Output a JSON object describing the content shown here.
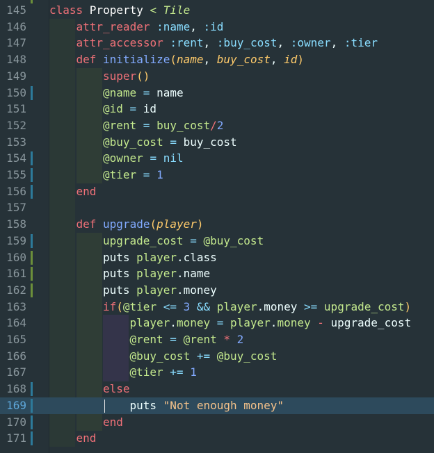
{
  "editor": {
    "theme_colors": {
      "background": "#263238",
      "line_number": "#89969c",
      "current_line": "#2d4a5c",
      "indent_guide": "#2e3b35",
      "git_modified": "#2d7a9a",
      "git_added": "#6c8f3a"
    },
    "current_line": 169,
    "lines": [
      {
        "num": "145",
        "indent": 0,
        "mark": "",
        "tokens": [
          [
            "kw",
            "class "
          ],
          [
            "cls",
            "Property "
          ],
          [
            "inh",
            "< Tile"
          ]
        ]
      },
      {
        "num": "146",
        "indent": 1,
        "mark": "",
        "tokens": [
          [
            "kw",
            "attr_reader "
          ],
          [
            "sym",
            ":name"
          ],
          [
            "id",
            ", "
          ],
          [
            "sym",
            ":id"
          ]
        ]
      },
      {
        "num": "147",
        "indent": 1,
        "mark": "",
        "tokens": [
          [
            "kw",
            "attr_accessor "
          ],
          [
            "sym",
            ":rent"
          ],
          [
            "id",
            ", "
          ],
          [
            "sym",
            ":buy_cost"
          ],
          [
            "id",
            ", "
          ],
          [
            "sym",
            ":owner"
          ],
          [
            "id",
            ", "
          ],
          [
            "sym",
            ":tier"
          ]
        ]
      },
      {
        "num": "148",
        "indent": 1,
        "mark": "",
        "tokens": [
          [
            "kw",
            "def "
          ],
          [
            "fn",
            "initialize"
          ],
          [
            "paren",
            "("
          ],
          [
            "param",
            "name"
          ],
          [
            "id",
            ", "
          ],
          [
            "param",
            "buy_cost"
          ],
          [
            "id",
            ", "
          ],
          [
            "param",
            "id"
          ],
          [
            "paren",
            ")"
          ]
        ]
      },
      {
        "num": "149",
        "indent": 2,
        "mark": "",
        "tokens": [
          [
            "kw",
            "super"
          ],
          [
            "paren",
            "()"
          ]
        ]
      },
      {
        "num": "150",
        "indent": 2,
        "mark": "mod",
        "tokens": [
          [
            "ivar",
            "@name "
          ],
          [
            "op",
            "= "
          ],
          [
            "id",
            "name"
          ]
        ]
      },
      {
        "num": "151",
        "indent": 2,
        "mark": "",
        "tokens": [
          [
            "ivar",
            "@id "
          ],
          [
            "op",
            "= "
          ],
          [
            "id",
            "id"
          ]
        ]
      },
      {
        "num": "152",
        "indent": 2,
        "mark": "",
        "tokens": [
          [
            "ivar",
            "@rent "
          ],
          [
            "op",
            "= "
          ],
          [
            "ivar",
            "buy_cost"
          ],
          [
            "kw",
            "/"
          ],
          [
            "num",
            "2"
          ]
        ]
      },
      {
        "num": "153",
        "indent": 2,
        "mark": "",
        "tokens": [
          [
            "ivar",
            "@buy_cost "
          ],
          [
            "op",
            "= "
          ],
          [
            "id",
            "buy_cost"
          ]
        ]
      },
      {
        "num": "154",
        "indent": 2,
        "mark": "mod",
        "tokens": [
          [
            "ivar",
            "@owner "
          ],
          [
            "op",
            "= "
          ],
          [
            "sym",
            "nil"
          ]
        ]
      },
      {
        "num": "155",
        "indent": 2,
        "mark": "mod",
        "tokens": [
          [
            "ivar",
            "@tier "
          ],
          [
            "op",
            "= "
          ],
          [
            "num",
            "1"
          ]
        ]
      },
      {
        "num": "156",
        "indent": 1,
        "mark": "mod",
        "tokens": [
          [
            "kw",
            "end"
          ]
        ]
      },
      {
        "num": "157",
        "indent": 0,
        "mark": "",
        "tokens": []
      },
      {
        "num": "158",
        "indent": 1,
        "mark": "",
        "tokens": [
          [
            "kw",
            "def "
          ],
          [
            "fn",
            "upgrade"
          ],
          [
            "paren",
            "("
          ],
          [
            "param",
            "player"
          ],
          [
            "paren",
            ")"
          ]
        ]
      },
      {
        "num": "159",
        "indent": 2,
        "mark": "mod",
        "tokens": [
          [
            "ivar",
            "upgrade_cost "
          ],
          [
            "op",
            "= "
          ],
          [
            "ivar",
            "@buy_cost"
          ]
        ]
      },
      {
        "num": "160",
        "indent": 2,
        "mark": "add",
        "tokens": [
          [
            "id",
            "puts "
          ],
          [
            "ivar",
            "player"
          ],
          [
            "id",
            "."
          ],
          [
            "id",
            "class"
          ]
        ]
      },
      {
        "num": "161",
        "indent": 2,
        "mark": "add",
        "tokens": [
          [
            "id",
            "puts "
          ],
          [
            "ivar",
            "player"
          ],
          [
            "id",
            "."
          ],
          [
            "id",
            "name"
          ]
        ]
      },
      {
        "num": "162",
        "indent": 2,
        "mark": "add",
        "tokens": [
          [
            "id",
            "puts "
          ],
          [
            "ivar",
            "player"
          ],
          [
            "id",
            "."
          ],
          [
            "id",
            "money"
          ]
        ]
      },
      {
        "num": "163",
        "indent": 2,
        "mark": "",
        "tokens": [
          [
            "kw",
            "if"
          ],
          [
            "paren",
            "("
          ],
          [
            "ivar",
            "@tier "
          ],
          [
            "op",
            "<= "
          ],
          [
            "num",
            "3 "
          ],
          [
            "op",
            "&& "
          ],
          [
            "ivar",
            "player"
          ],
          [
            "id",
            "."
          ],
          [
            "id",
            "money "
          ],
          [
            "op",
            ">= "
          ],
          [
            "ivar",
            "upgrade_cost"
          ],
          [
            "paren",
            ")"
          ]
        ]
      },
      {
        "num": "164",
        "indent": 3,
        "mark": "",
        "tokens": [
          [
            "ivar",
            "player"
          ],
          [
            "id",
            "."
          ],
          [
            "ivar",
            "money "
          ],
          [
            "op",
            "= "
          ],
          [
            "ivar",
            "player"
          ],
          [
            "id",
            "."
          ],
          [
            "ivar",
            "money "
          ],
          [
            "kw",
            "- "
          ],
          [
            "id",
            "upgrade_cost"
          ]
        ]
      },
      {
        "num": "165",
        "indent": 3,
        "mark": "",
        "tokens": [
          [
            "ivar",
            "@rent "
          ],
          [
            "op",
            "= "
          ],
          [
            "ivar",
            "@rent "
          ],
          [
            "kw",
            "* "
          ],
          [
            "num",
            "2"
          ]
        ]
      },
      {
        "num": "166",
        "indent": 3,
        "mark": "",
        "tokens": [
          [
            "ivar",
            "@buy_cost "
          ],
          [
            "op",
            "+= "
          ],
          [
            "ivar",
            "@buy_cost"
          ]
        ]
      },
      {
        "num": "167",
        "indent": 3,
        "mark": "",
        "tokens": [
          [
            "ivar",
            "@tier "
          ],
          [
            "op",
            "+= "
          ],
          [
            "num",
            "1"
          ]
        ]
      },
      {
        "num": "168",
        "indent": 2,
        "mark": "mod",
        "tokens": [
          [
            "kw",
            "else"
          ]
        ]
      },
      {
        "num": "169",
        "indent": 3,
        "mark": "mod",
        "tokens": [
          [
            "id",
            "puts "
          ],
          [
            "str",
            "\"Not enough money\""
          ]
        ]
      },
      {
        "num": "170",
        "indent": 2,
        "mark": "mod",
        "tokens": [
          [
            "kw",
            "end"
          ]
        ]
      },
      {
        "num": "171",
        "indent": 1,
        "mark": "mod",
        "tokens": [
          [
            "kw",
            "end"
          ]
        ]
      }
    ]
  }
}
